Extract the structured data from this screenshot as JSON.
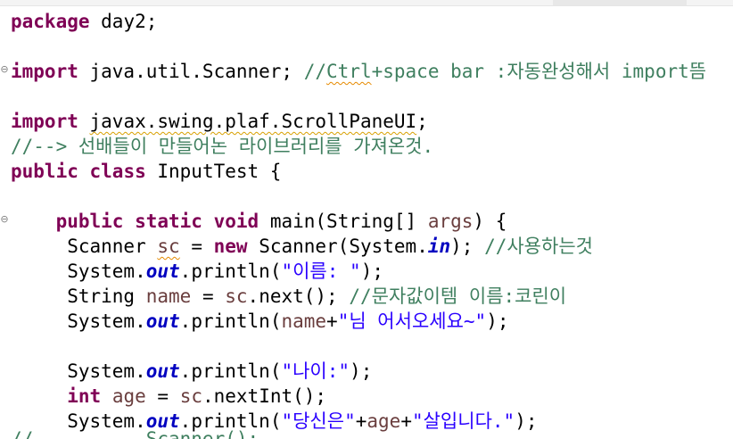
{
  "code": {
    "line1": {
      "kw": "package",
      "rest": " day2;"
    },
    "line2": {
      "kw": "import",
      "pkg": " java.util.Scanner; ",
      "comment_a": "//",
      "comment_ctrl": "Ctrl",
      "comment_b": "+space bar :자동완성해서 import뜸"
    },
    "line3": {
      "kw": "import",
      "pkg_under": "javax.swing.plaf.ScrollPaneUI",
      "pkg_end": ";"
    },
    "line4": {
      "comment": "//--> 선배들이 만들어논 라이브러리를 가져온것."
    },
    "line5": {
      "kw1": "public",
      "kw2": "class",
      "rest": " InputTest {"
    },
    "line6": {
      "indent": "    ",
      "kw1": "public",
      "kw2": "static",
      "kw3": "void",
      "rest_a": " main(String[] ",
      "var": "args",
      "rest_b": ") {"
    },
    "line7": {
      "indent": "     ",
      "a": "Scanner ",
      "var": "sc",
      "b": " = ",
      "kw": "new",
      "c": " Scanner(System.",
      "field": "in",
      "d": "); ",
      "comment": "//사용하는것"
    },
    "line8": {
      "indent": "     ",
      "a": "System.",
      "field": "out",
      "b": ".println(",
      "str": "\"이름: \"",
      "c": ");"
    },
    "line9": {
      "indent": "     ",
      "a": "String ",
      "var1": "name",
      "b": " = ",
      "var2": "sc",
      "c": ".next(); ",
      "comment": "//문자값이템 이름:코린이"
    },
    "line10": {
      "indent": "     ",
      "a": "System.",
      "field": "out",
      "b": ".println(",
      "var": "name",
      "c": "+",
      "str": "\"님 어서오세요~\"",
      "d": ");"
    },
    "line11": {
      "indent": "     ",
      "a": "System.",
      "field": "out",
      "b": ".println(",
      "str": "\"나이:\"",
      "c": ");"
    },
    "line12": {
      "indent": "     ",
      "kw": "int",
      "a": " ",
      "var1": "age",
      "b": " = ",
      "var2": "sc",
      "c": ".nextInt();"
    },
    "line13": {
      "indent": "     ",
      "a": "System.",
      "field": "out",
      "b": ".println(",
      "str1": "\"당신은\"",
      "c": "+",
      "var": "age",
      "d": "+",
      "str2": "\"살입니다.\"",
      "e": ");"
    },
    "line14": {
      "partial": "//       ...Scanner();"
    }
  },
  "gutter": {
    "fold_symbol": "⊖"
  }
}
